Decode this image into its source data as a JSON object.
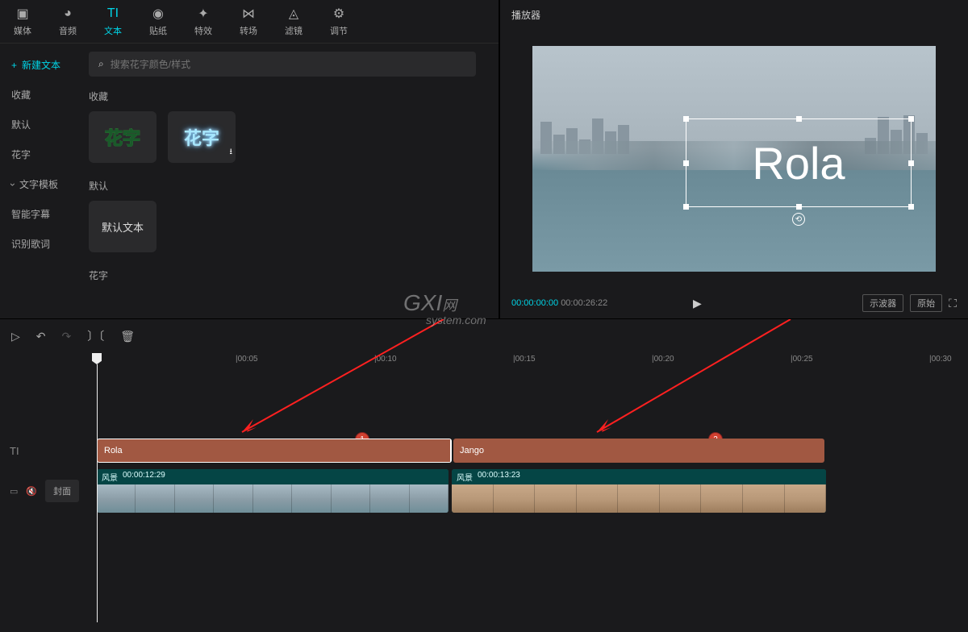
{
  "topTabs": [
    {
      "label": "媒体",
      "icon": "▣"
    },
    {
      "label": "音频",
      "icon": "◕"
    },
    {
      "label": "文本",
      "icon": "TI",
      "active": true
    },
    {
      "label": "贴纸",
      "icon": "◉"
    },
    {
      "label": "特效",
      "icon": "✦"
    },
    {
      "label": "转场",
      "icon": "⋈"
    },
    {
      "label": "滤镜",
      "icon": "◬"
    },
    {
      "label": "调节",
      "icon": "⚙"
    }
  ],
  "sidebar": [
    {
      "label": "新建文本",
      "active": true,
      "plus": true
    },
    {
      "label": "收藏"
    },
    {
      "label": "默认"
    },
    {
      "label": "花字"
    },
    {
      "label": "文字模板",
      "chevron": true
    },
    {
      "label": "智能字幕"
    },
    {
      "label": "识别歌词"
    }
  ],
  "search": {
    "placeholder": "搜索花字颜色/样式"
  },
  "sections": {
    "fav": "收藏",
    "default": "默认",
    "huazi": "花字"
  },
  "thumbLabels": {
    "t1": "花字",
    "t2": "花字",
    "def": "默认文本"
  },
  "player": {
    "title": "播放器",
    "overlayText": "Rola",
    "timeCurrent": "00:00:00:00",
    "timeTotal": "00:00:26:22",
    "btnOscilloscope": "示波器",
    "btnOriginal": "原始"
  },
  "watermark": {
    "big": "GXI",
    "small": "system.com",
    "suffix": "网"
  },
  "timeline": {
    "ruler": [
      "|00:05",
      "|00:10",
      "|00:15",
      "|00:20",
      "|00:25",
      "|00:30"
    ],
    "textTrack": {
      "icon": "TI"
    },
    "videoTrack": {
      "cover": "封面"
    },
    "clips": {
      "text1": "Rola",
      "text2": "Jango",
      "video1": {
        "name": "风景",
        "dur": "00:00:12:29"
      },
      "video2": {
        "name": "风景",
        "dur": "00:00:13:23"
      }
    },
    "badges": {
      "b1": "1",
      "b2": "2"
    }
  }
}
